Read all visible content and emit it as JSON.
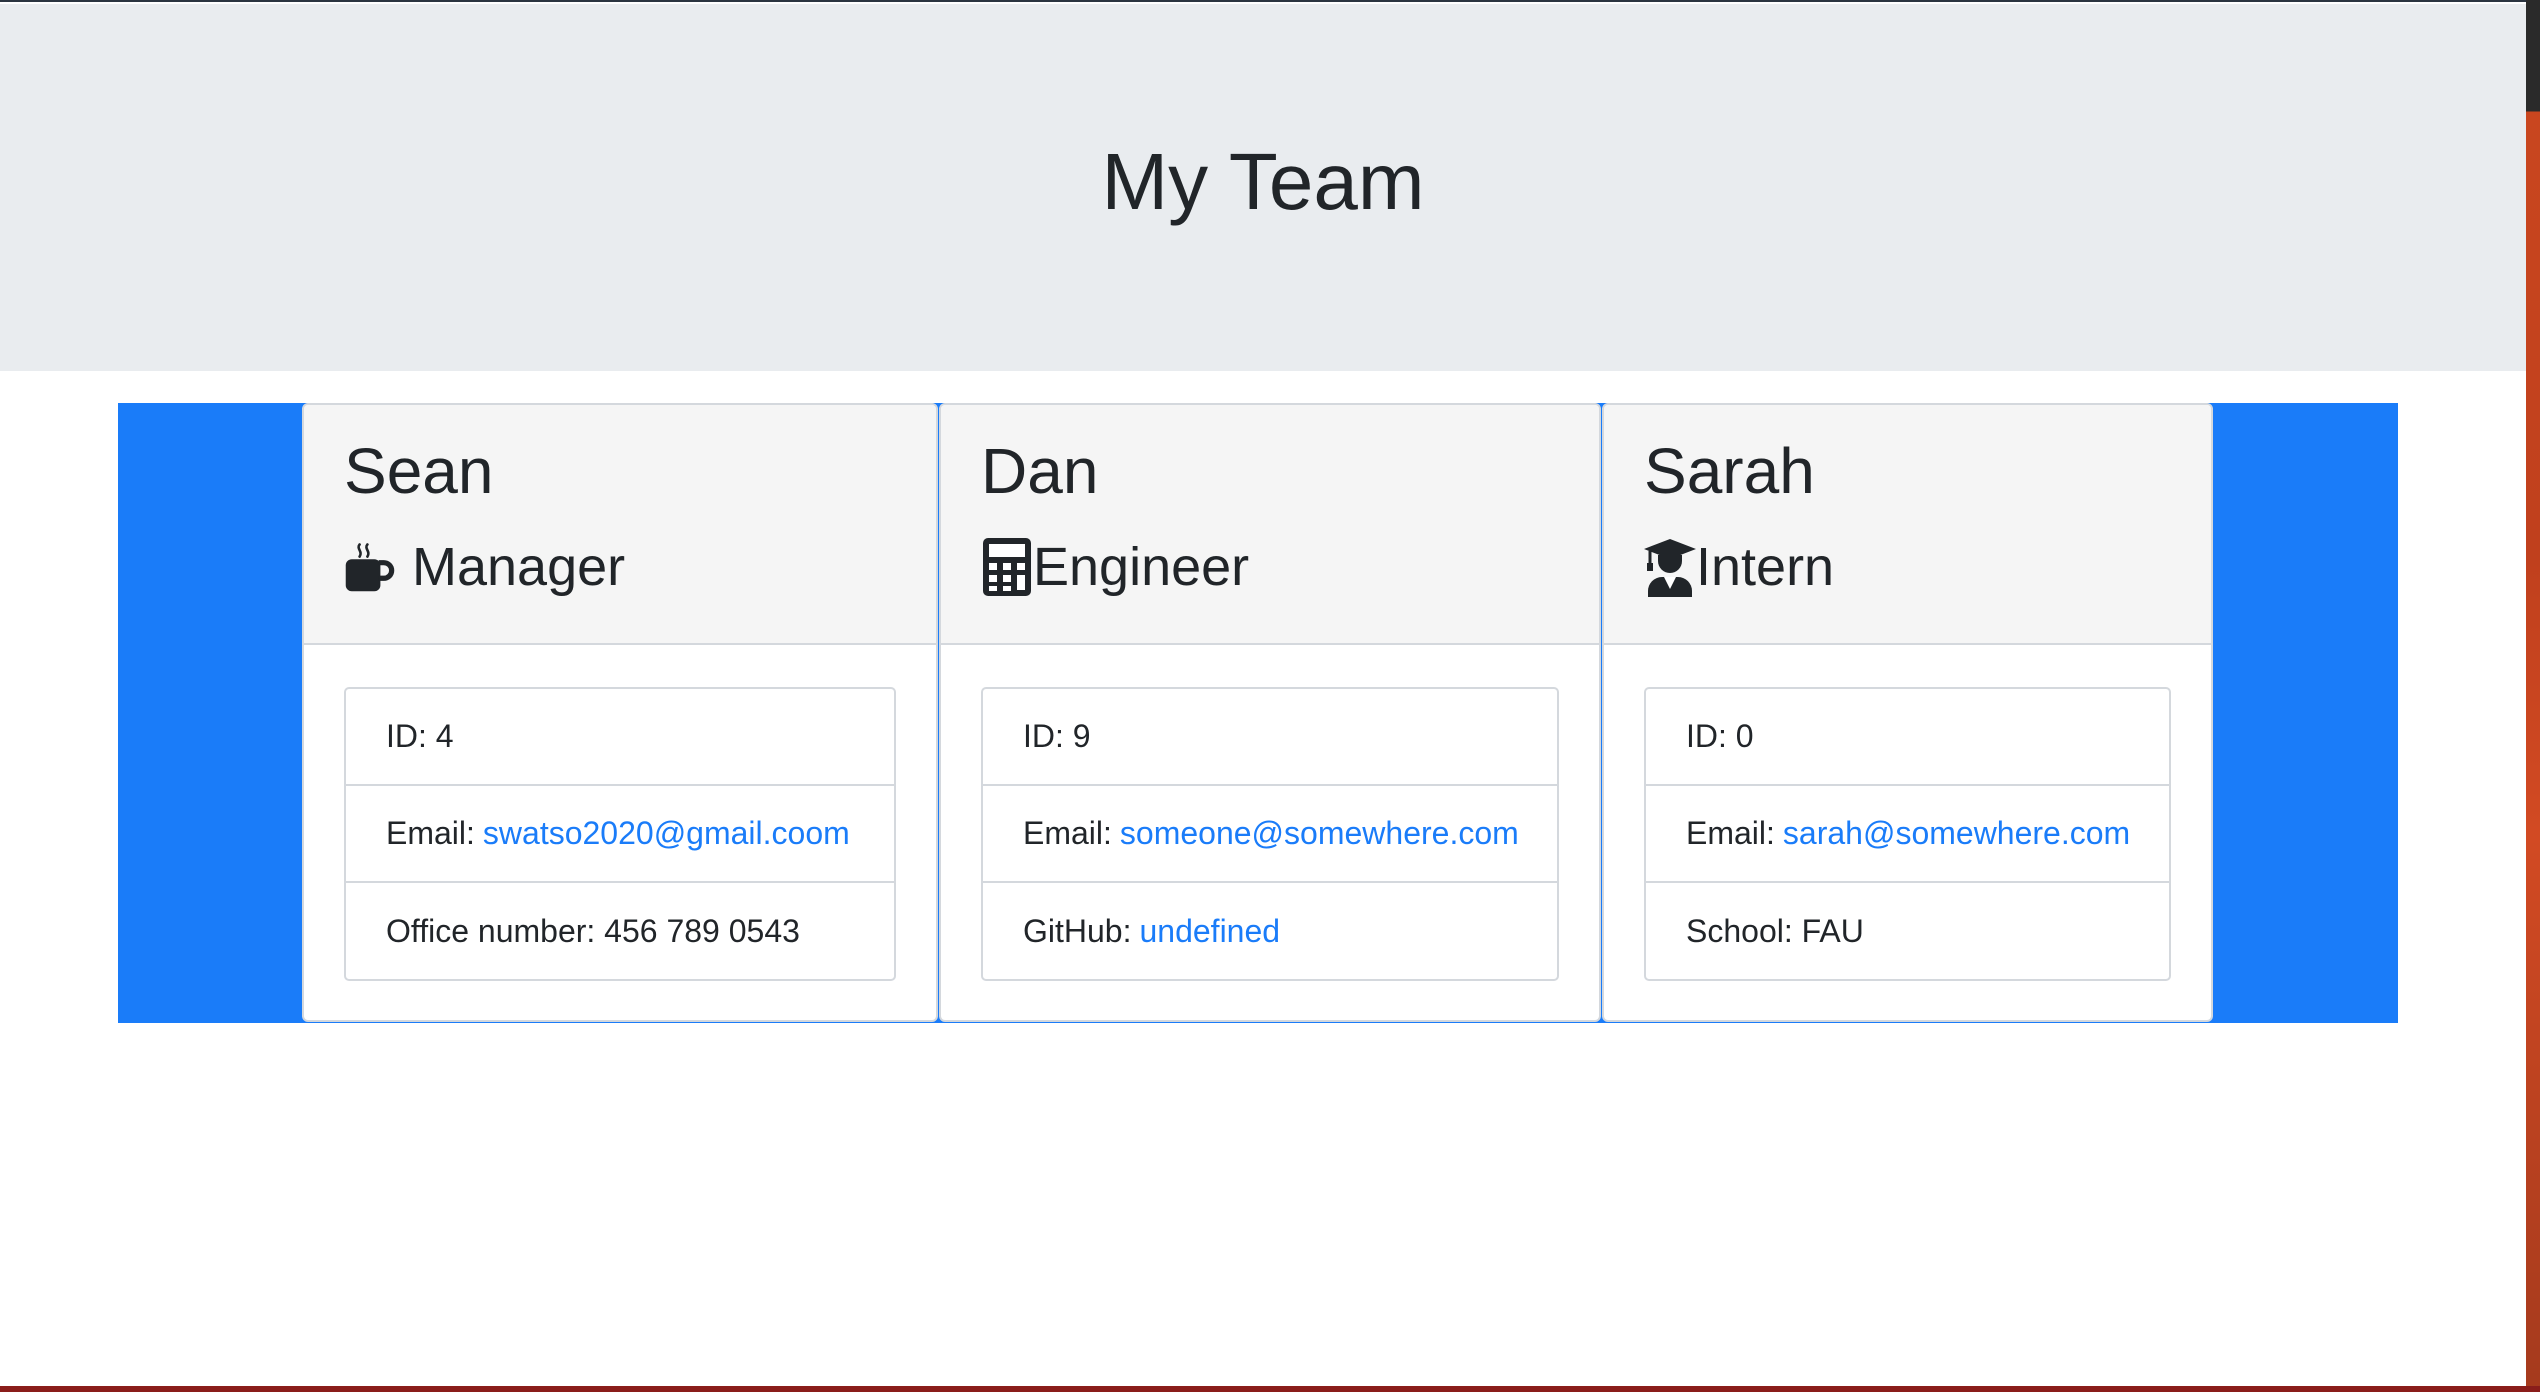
{
  "header": {
    "title": "My Team"
  },
  "colors": {
    "accent": "#1a7cf9",
    "jumbotron": "#e9ecef",
    "card_header": "#f5f5f5",
    "text": "#212529"
  },
  "employees": [
    {
      "name": "Sean",
      "role": "Manager",
      "role_icon": "coffee-mug-icon",
      "items": [
        {
          "label": "ID: 4",
          "value": ""
        },
        {
          "label": "Email:",
          "value": "swatso2020@gmail.coom"
        },
        {
          "label": "Office number: 456 789 0543",
          "value": ""
        }
      ]
    },
    {
      "name": "Dan",
      "role": "Engineer",
      "role_icon": "calculator-icon",
      "items": [
        {
          "label": "ID: 9",
          "value": ""
        },
        {
          "label": "Email:",
          "value": "someone@somewhere.com"
        },
        {
          "label": "GitHub:",
          "value": "undefined"
        }
      ]
    },
    {
      "name": "Sarah",
      "role": "Intern",
      "role_icon": "graduate-icon",
      "items": [
        {
          "label": "ID: 0",
          "value": ""
        },
        {
          "label": "Email:",
          "value": "sarah@somewhere.com"
        },
        {
          "label": "School: FAU",
          "value": ""
        }
      ]
    }
  ]
}
